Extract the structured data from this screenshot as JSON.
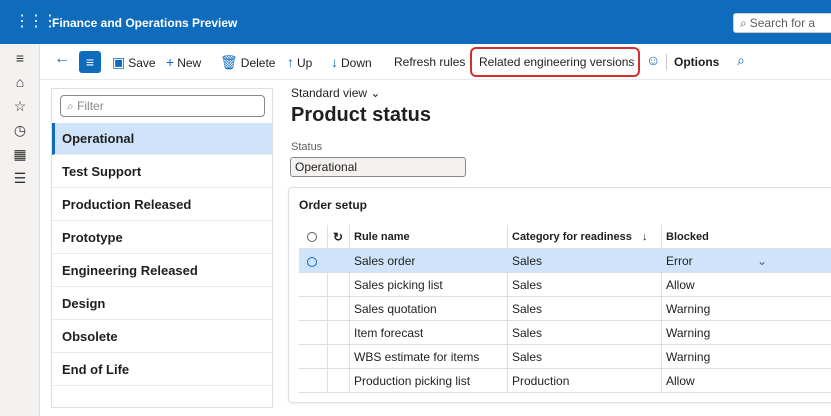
{
  "app": {
    "title": "Finance and Operations Preview",
    "search_placeholder": "Search for a"
  },
  "rail": {
    "icons": [
      "hamburger-icon",
      "home-icon",
      "star-icon",
      "clock-icon",
      "workspace-icon",
      "list-icon"
    ]
  },
  "actions": {
    "save": "Save",
    "new": "New",
    "delete": "Delete",
    "up": "Up",
    "down": "Down",
    "refresh_rules": "Refresh rules",
    "related_engineering_versions": "Related engineering versions",
    "options": "Options"
  },
  "list": {
    "filter_placeholder": "Filter",
    "items": [
      {
        "label": "Operational",
        "selected": true
      },
      {
        "label": "Test Support",
        "selected": false
      },
      {
        "label": "Production Released",
        "selected": false
      },
      {
        "label": "Prototype",
        "selected": false
      },
      {
        "label": "Engineering Released",
        "selected": false
      },
      {
        "label": "Design",
        "selected": false
      },
      {
        "label": "Obsolete",
        "selected": false
      },
      {
        "label": "End of Life",
        "selected": false
      }
    ]
  },
  "main": {
    "view_label": "Standard view",
    "title": "Product status",
    "status_label": "Status",
    "status_value": "Operational"
  },
  "order_setup": {
    "title": "Order setup",
    "columns": [
      "Rule name",
      "Category for readiness",
      "Blocked"
    ],
    "sort_indicator": "↓",
    "rows": [
      {
        "rule": "Sales order",
        "category": "Sales",
        "blocked": "Error",
        "selected": true
      },
      {
        "rule": "Sales picking list",
        "category": "Sales",
        "blocked": "Allow",
        "selected": false
      },
      {
        "rule": "Sales quotation",
        "category": "Sales",
        "blocked": "Warning",
        "selected": false
      },
      {
        "rule": "Item forecast",
        "category": "Sales",
        "blocked": "Warning",
        "selected": false
      },
      {
        "rule": "WBS estimate for items",
        "category": "Sales",
        "blocked": "Warning",
        "selected": false
      },
      {
        "rule": "Production picking list",
        "category": "Production",
        "blocked": "Allow",
        "selected": false
      }
    ]
  },
  "colors": {
    "brand": "#0f6cbd",
    "selected_bg": "#cfe4fa",
    "highlight": "#d32f2f"
  }
}
